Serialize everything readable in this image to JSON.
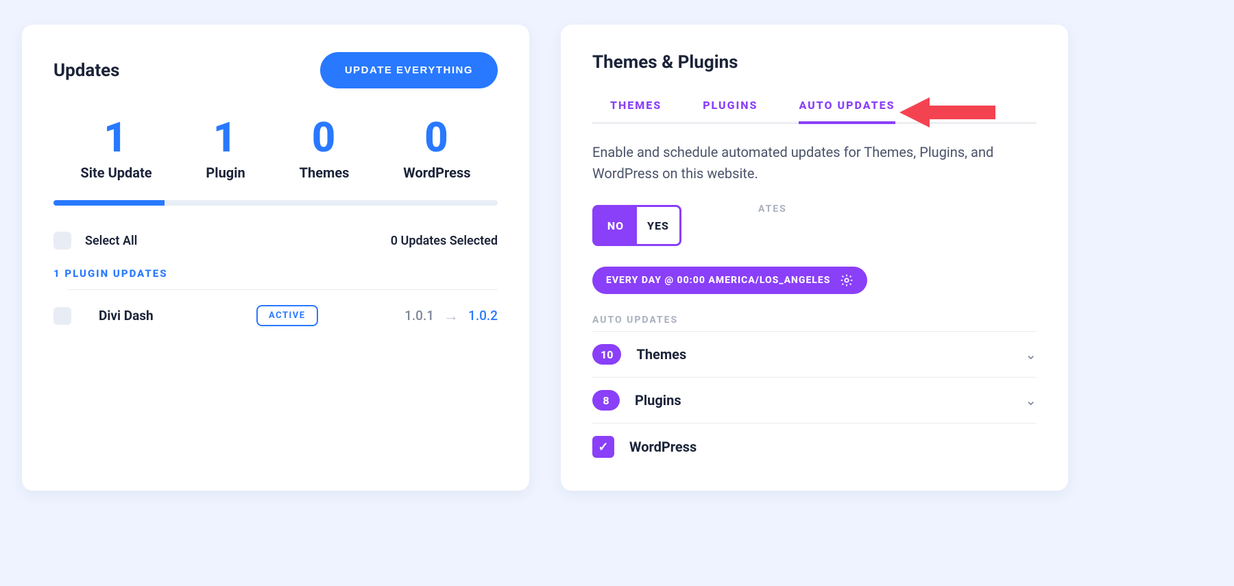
{
  "left": {
    "title": "Updates",
    "update_everything": "UPDATE EVERYTHING",
    "stats": {
      "site_update": {
        "value": "1",
        "label": "Site Update"
      },
      "plugin": {
        "value": "1",
        "label": "Plugin"
      },
      "themes": {
        "value": "0",
        "label": "Themes"
      },
      "wordpress": {
        "value": "0",
        "label": "WordPress"
      }
    },
    "select_all": "Select All",
    "updates_selected": "0 Updates Selected",
    "plugin_updates_heading": "1 PLUGIN UPDATES",
    "plugin_row": {
      "name": "Divi Dash",
      "badge": "ACTIVE",
      "current": "1.0.1",
      "next": "1.0.2"
    }
  },
  "right": {
    "title": "Themes & Plugins",
    "tabs": {
      "themes": "THEMES",
      "plugins": "PLUGINS",
      "auto_updates": "AUTO UPDATES"
    },
    "desc": "Enable and schedule automated updates for Themes, Plugins, and WordPress on this website.",
    "caption_toggle": "ATES",
    "toggle": {
      "no": "NO",
      "yes": "YES"
    },
    "caption_schedule": "",
    "schedule": "EVERY DAY @ 00:00  AMERICA/LOS_ANGELES",
    "auto_updates_caption": "AUTO UPDATES",
    "rows": {
      "themes": {
        "count": "10",
        "label": "Themes"
      },
      "plugins": {
        "count": "8",
        "label": "Plugins"
      },
      "wordpress": {
        "label": "WordPress"
      }
    }
  }
}
